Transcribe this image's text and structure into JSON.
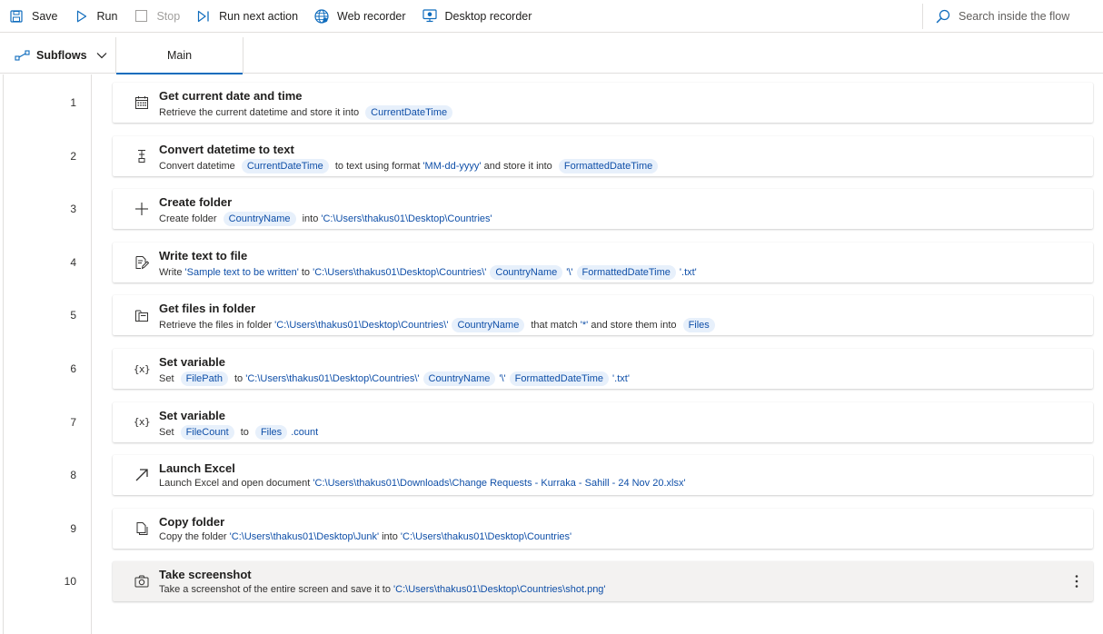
{
  "toolbar": {
    "save": "Save",
    "run": "Run",
    "stop": "Stop",
    "run_next": "Run next action",
    "web_recorder": "Web recorder",
    "desktop_recorder": "Desktop recorder",
    "search_placeholder": "Search inside the flow"
  },
  "tabs": {
    "subflows": "Subflows",
    "main": "Main"
  },
  "colors": {
    "accent": "#0f6cbd",
    "pill_bg": "#e7f0fb",
    "pill_text": "#0f4fa8"
  },
  "actions": [
    {
      "num": "1",
      "icon": "calendar-icon",
      "title": "Get current date and time",
      "desc": [
        {
          "t": "Retrieve the current datetime and store it into "
        },
        {
          "v": "CurrentDateTime"
        }
      ]
    },
    {
      "num": "2",
      "icon": "convert-icon",
      "title": "Convert datetime to text",
      "desc": [
        {
          "t": "Convert datetime "
        },
        {
          "v": "CurrentDateTime"
        },
        {
          "t": " to text using format "
        },
        {
          "s": "'MM-dd-yyyy'"
        },
        {
          "t": " and store it into "
        },
        {
          "v": "FormattedDateTime"
        }
      ]
    },
    {
      "num": "3",
      "icon": "plus-icon",
      "title": "Create folder",
      "desc": [
        {
          "t": "Create folder "
        },
        {
          "v": "CountryName"
        },
        {
          "t": " into "
        },
        {
          "s": "'C:\\Users\\thakus01\\Desktop\\Countries'"
        }
      ]
    },
    {
      "num": "4",
      "icon": "write-file-icon",
      "title": "Write text to file",
      "desc": [
        {
          "t": "Write "
        },
        {
          "s": "'Sample text to be written'"
        },
        {
          "t": " to "
        },
        {
          "s": "'C:\\Users\\thakus01\\Desktop\\Countries\\'"
        },
        {
          "v": "CountryName"
        },
        {
          "s": "'\\'"
        },
        {
          "v": "FormattedDateTime"
        },
        {
          "s": "'.txt'"
        }
      ]
    },
    {
      "num": "5",
      "icon": "files-icon",
      "title": "Get files in folder",
      "desc": [
        {
          "t": "Retrieve the files in folder "
        },
        {
          "s": "'C:\\Users\\thakus01\\Desktop\\Countries\\'"
        },
        {
          "v": "CountryName"
        },
        {
          "t": " that match "
        },
        {
          "s": "'*'"
        },
        {
          "t": " and store them into "
        },
        {
          "v": "Files"
        }
      ]
    },
    {
      "num": "6",
      "icon": "variable-icon",
      "title": "Set variable",
      "desc": [
        {
          "t": "Set "
        },
        {
          "v": "FilePath"
        },
        {
          "t": " to "
        },
        {
          "s": "'C:\\Users\\thakus01\\Desktop\\Countries\\'"
        },
        {
          "v": "CountryName"
        },
        {
          "s": "'\\'"
        },
        {
          "v": "FormattedDateTime"
        },
        {
          "s": "'.txt'"
        }
      ]
    },
    {
      "num": "7",
      "icon": "variable-icon",
      "title": "Set variable",
      "desc": [
        {
          "t": "Set "
        },
        {
          "v": "FileCount"
        },
        {
          "t": " to "
        },
        {
          "v": "Files"
        },
        {
          "s": ".count"
        }
      ]
    },
    {
      "num": "8",
      "icon": "launch-arrow-icon",
      "title": "Launch Excel",
      "desc": [
        {
          "t": "Launch Excel and open document "
        },
        {
          "s": "'C:\\Users\\thakus01\\Downloads\\Change Requests - Kurraka - Sahill - 24 Nov 20.xlsx'"
        }
      ]
    },
    {
      "num": "9",
      "icon": "copy-icon",
      "title": "Copy folder",
      "desc": [
        {
          "t": "Copy the folder "
        },
        {
          "s": "'C:\\Users\\thakus01\\Desktop\\Junk'"
        },
        {
          "t": " into "
        },
        {
          "s": "'C:\\Users\\thakus01\\Desktop\\Countries'"
        }
      ]
    },
    {
      "num": "10",
      "icon": "camera-icon",
      "title": "Take screenshot",
      "selected": true,
      "desc": [
        {
          "t": "Take a screenshot of the entire screen and save it to "
        },
        {
          "s": "'C:\\Users\\thakus01\\Desktop\\Countries\\shot.png'"
        }
      ]
    }
  ]
}
